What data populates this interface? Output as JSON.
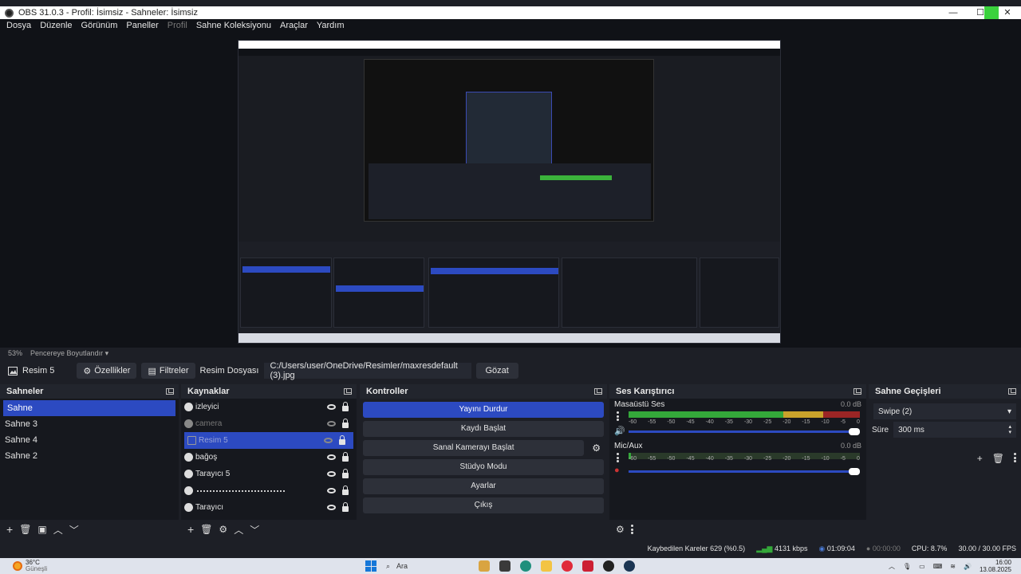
{
  "window": {
    "title": "OBS 31.0.3 - Profil: İsimsiz - Sahneler: İsimsiz",
    "controls": [
      "—",
      "☐",
      "✕"
    ]
  },
  "menu": {
    "items": [
      "Dosya",
      "Düzenle",
      "Görünüm",
      "Paneller",
      "Profil",
      "Sahne Koleksiyonu",
      "Araçlar",
      "Yardım"
    ]
  },
  "zoom": {
    "percent": "53%",
    "mode": "Pencereye Boyutlandır"
  },
  "source_toolbar": {
    "selected_source": "Resim 5",
    "properties_label": "Özellikler",
    "filters_label": "Filtreler",
    "file_label": "Resim Dosyası",
    "file_path": "C:/Users/user/OneDrive/Resimler/maxresdefault (3).jpg",
    "browse_label": "Gözat"
  },
  "scenes": {
    "title": "Sahneler",
    "items": [
      "Sahne",
      "Sahne 3",
      "Sahne 4",
      "Sahne 2"
    ],
    "active_index": 0
  },
  "sources": {
    "title": "Kaynaklar",
    "items": [
      {
        "label": "izleyici",
        "visible": true,
        "icon": "browser-icon"
      },
      {
        "label": "camera",
        "visible": false,
        "icon": "browser-icon"
      },
      {
        "label": "Resim 5",
        "visible": false,
        "icon": "image-icon"
      },
      {
        "label": "bağoş",
        "visible": true,
        "icon": "browser-icon"
      },
      {
        "label": "Tarayıcı 5",
        "visible": true,
        "icon": "browser-icon"
      },
      {
        "label": "",
        "visible": true,
        "icon": "browser-icon"
      },
      {
        "label": "Tarayıcı",
        "visible": true,
        "icon": "browser-icon"
      }
    ],
    "active_index": 2
  },
  "controls": {
    "title": "Kontroller",
    "stop_stream": "Yayını Durdur",
    "start_record": "Kaydı Başlat",
    "start_vcam": "Sanal Kamerayı Başlat",
    "studio_mode": "Stüdyo Modu",
    "settings": "Ayarlar",
    "exit": "Çıkış"
  },
  "mixer": {
    "title": "Ses Karıştırıcı",
    "channels": [
      {
        "name": "Masaüstü Ses",
        "db": "0.0 dB",
        "level": 1.0
      },
      {
        "name": "Mic/Aux",
        "db": "0.0 dB",
        "level": 0.01
      }
    ],
    "scale": [
      "-60",
      "-55",
      "-50",
      "-45",
      "-40",
      "-35",
      "-30",
      "-25",
      "-20",
      "-15",
      "-10",
      "-5",
      "0"
    ]
  },
  "transitions": {
    "title": "Sahne Geçişleri",
    "selected": "Swipe (2)",
    "duration_label": "Süre",
    "duration_value": "300 ms"
  },
  "status": {
    "dropped_frames": "Kaybedilen Kareler 629 (%0.5)",
    "bitrate": "4131 kbps",
    "stream_time": "01:09:04",
    "record_time": "00:00:00",
    "cpu": "CPU: 8.7%",
    "fps": "30.00 / 30.00 FPS"
  },
  "taskbar": {
    "temperature": "36°C",
    "weather": "Güneşli",
    "search_placeholder": "Ara",
    "time": "16:00",
    "date": "13.08.2025"
  },
  "colors": {
    "accent": "#2c4ac1",
    "meter_green": "#34a83a",
    "meter_yellow": "#c9a22b",
    "meter_red": "#9b2525"
  }
}
